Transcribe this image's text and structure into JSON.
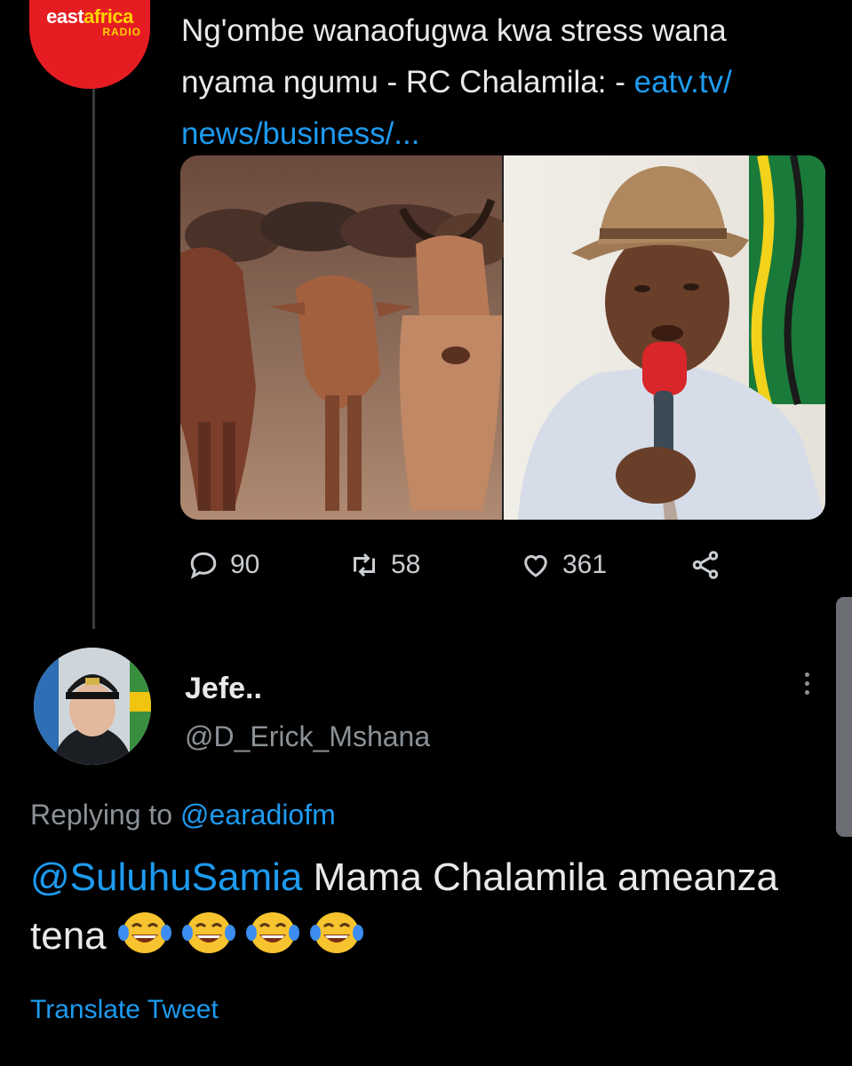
{
  "source": {
    "logo": {
      "part1": "east",
      "part2": "africa",
      "sub": "RADIO"
    }
  },
  "tweet": {
    "text": "Ng'ombe wanaofugwa kwa stress wana nyama ngumu - RC Chalamila: - ",
    "link_text": "eatv.tv/ news/business/...",
    "replies": "90",
    "retweets": "58",
    "likes": "361"
  },
  "reply": {
    "name": "Jefe..",
    "handle": "@D_Erick_Mshana",
    "replying_label": "Replying to",
    "replying_to": "@earadiofm",
    "mention": "@SuluhuSamia",
    "text": " Mama Chalamila ameanza tena",
    "emoji_count": 4,
    "translate_label": "Translate Tweet"
  },
  "colors": {
    "background": "#000000",
    "link": "#1d9bf0",
    "text": "#e7e9ea",
    "muted": "#8b9196",
    "brand_red": "#e51d22"
  },
  "icons": [
    "reply-icon",
    "retweet-icon",
    "like-icon",
    "share-icon",
    "more-options-icon"
  ]
}
